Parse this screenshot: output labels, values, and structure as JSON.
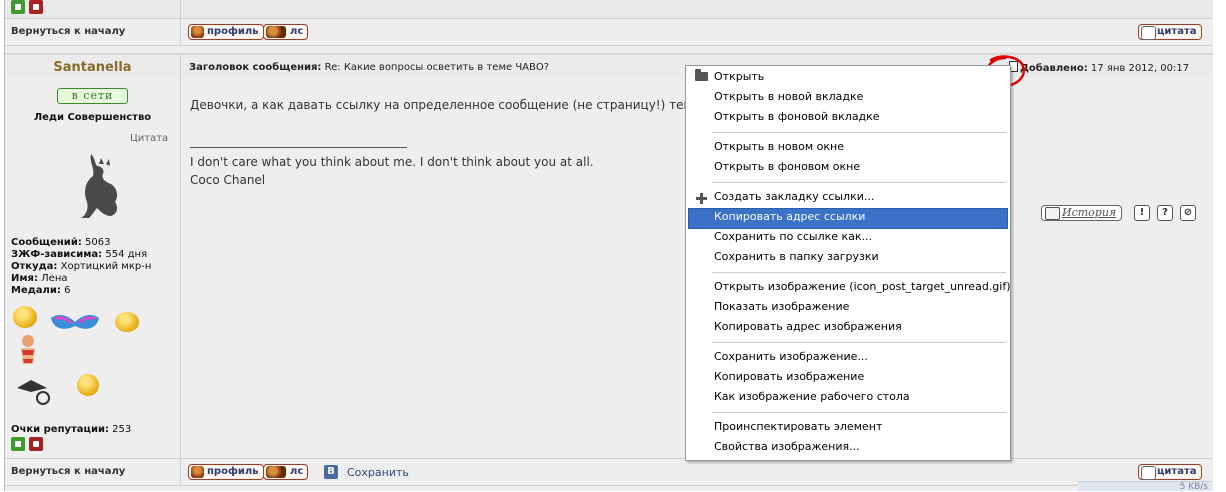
{
  "nav": {
    "back_to_top": "Вернуться к началу",
    "profile_label": "профиль",
    "pm_label": "лс",
    "quote_label": "цитата",
    "save_label": "Сохранить",
    "vk_label": "В"
  },
  "post": {
    "author": "Santanella",
    "subject_prefix": "Заголовок сообщения:",
    "subject": "Re: Какие вопросы осветить в теме ЧАВО?",
    "added_prefix": "Добавлено:",
    "added_date": "17 янв 2012, 00:17",
    "online_badge": "в сети",
    "rank": "Леди Совершенство",
    "quote_tag": "Цитата",
    "message": "Девочки, а как давать ссылку на определенное сообщение (не страницу!) темы?",
    "signature_line1": "I don't care what you think about me. I don't think about you at all.",
    "signature_line2": "Coco Chanel",
    "history_label": "История",
    "icons": [
      "report-icon",
      "help-icon",
      "block-icon"
    ]
  },
  "profile": {
    "posts_label": "Сообщений:",
    "posts_value": "5063",
    "addict_label": "ЗЖФ-зависима:",
    "addict_value": "554 дня",
    "from_label": "Откуда:",
    "from_value": "Хортицкий мкр-н",
    "name_label": "Имя:",
    "name_value": "Лена",
    "medals_label": "Медали:",
    "medals_value": "6",
    "reputation_label": "Очки репутации:",
    "reputation_value": "253"
  },
  "context_menu": {
    "items": [
      "Открыть",
      "Открыть в новой вкладке",
      "Открыть в фоновой вкладке",
      "Открыть в новом окне",
      "Открыть в фоновом окне",
      "Создать закладку ссылки...",
      "Копировать адрес ссылки",
      "Сохранить по ссылке как...",
      "Сохранить в папку загрузки",
      "Открыть изображение (icon_post_target_unread.gif)",
      "Показать изображение",
      "Копировать адрес изображения",
      "Сохранить изображение...",
      "Копировать изображение",
      "Как изображение рабочего стола",
      "Проинспектировать элемент",
      "Свойства изображения..."
    ],
    "highlighted": "Копировать адрес ссылки"
  },
  "status": {
    "speed": "5 KB/s"
  },
  "colors": {
    "highlight": "#3a72c8",
    "author": "#8a6a2a",
    "online": "#2f7d1d",
    "button_text": "#2a3c74",
    "annotation": "#e00000"
  }
}
